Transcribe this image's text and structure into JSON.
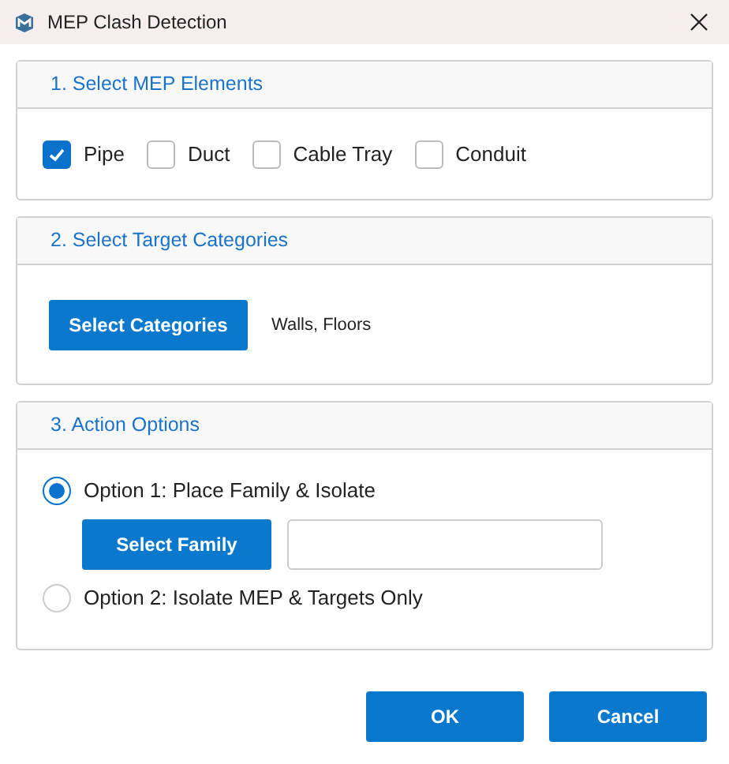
{
  "window": {
    "title": "MEP Clash Detection"
  },
  "section_1": {
    "title": "1. Select MEP Elements",
    "checkboxes": [
      {
        "label": "Pipe",
        "checked": true
      },
      {
        "label": "Duct",
        "checked": false
      },
      {
        "label": "Cable Tray",
        "checked": false
      },
      {
        "label": "Conduit",
        "checked": false
      }
    ]
  },
  "section_2": {
    "title": "2. Select Target Categories",
    "button": "Select Categories",
    "selection": "Walls, Floors"
  },
  "section_3": {
    "title": "3. Action Options",
    "options": [
      {
        "label": "Option 1: Place Family & Isolate",
        "selected": true,
        "button": "Select Family"
      },
      {
        "label": "Option 2: Isolate MEP & Targets Only",
        "selected": false
      }
    ]
  },
  "buttons": [
    "OK",
    "Cancel"
  ]
}
